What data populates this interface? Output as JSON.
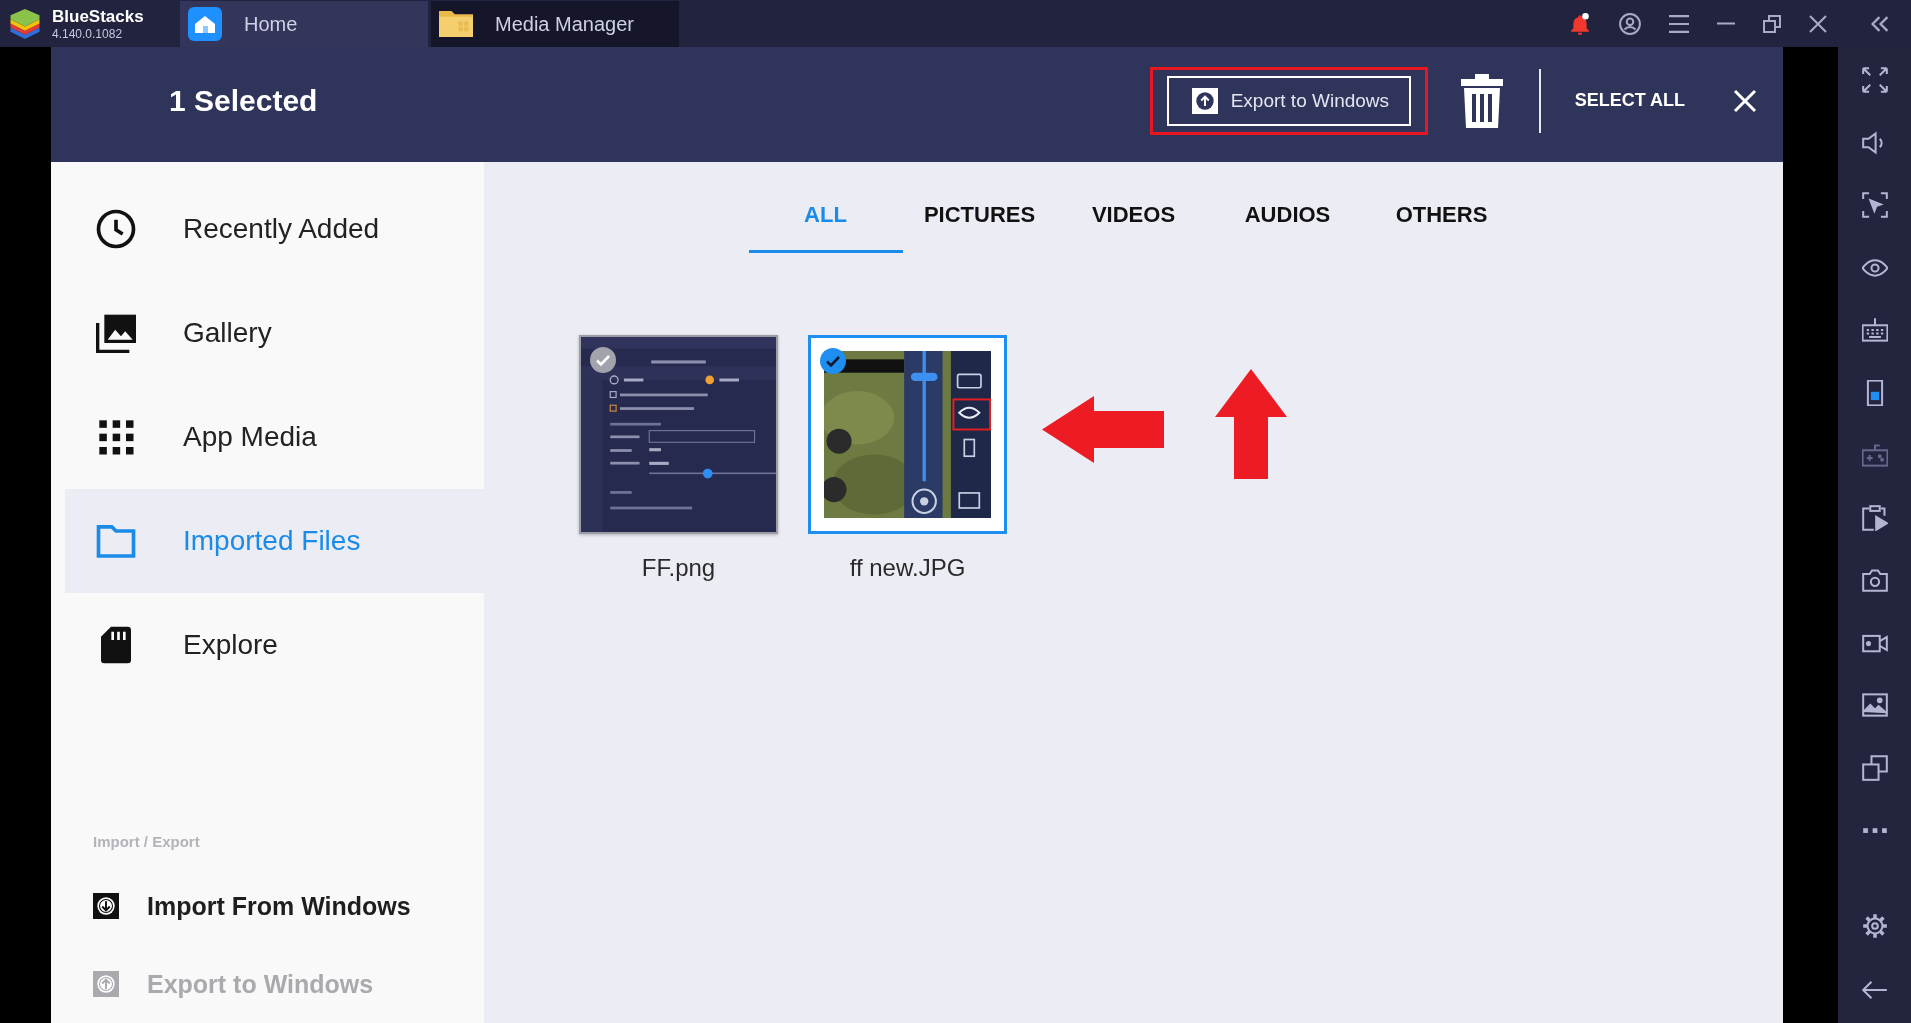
{
  "titlebar": {
    "app_name": "BlueStacks",
    "version": "4.140.0.1082",
    "tabs": [
      {
        "label": "Home",
        "kind": "home",
        "selected": false
      },
      {
        "label": "Media Manager",
        "kind": "folder",
        "selected": true
      }
    ],
    "notification_unread": true
  },
  "header": {
    "title": "1 Selected",
    "export_button": {
      "label": "Export to Windows",
      "highlighted": true
    },
    "select_all": "SELECT ALL"
  },
  "sidebar": {
    "items": [
      {
        "label": "Recently Added",
        "kind": "recent",
        "selected": false
      },
      {
        "label": "Gallery",
        "kind": "gallery",
        "selected": false
      },
      {
        "label": "App Media",
        "kind": "apps",
        "selected": false
      },
      {
        "label": "Imported Files",
        "kind": "folder",
        "selected": true
      },
      {
        "label": "Explore",
        "kind": "storage",
        "selected": false
      }
    ],
    "section_label": "Import / Export",
    "actions": [
      {
        "label": "Import From Windows",
        "kind": "import",
        "disabled": false
      },
      {
        "label": "Export to Windows",
        "kind": "export",
        "disabled": true
      }
    ]
  },
  "filter_tabs": [
    {
      "label": "ALL",
      "selected": true
    },
    {
      "label": "PICTURES",
      "selected": false
    },
    {
      "label": "VIDEOS",
      "selected": false
    },
    {
      "label": "AUDIOS",
      "selected": false
    },
    {
      "label": "OTHERS",
      "selected": false
    }
  ],
  "files": [
    {
      "name": "FF.png",
      "kind": "settings",
      "selected": false
    },
    {
      "name": "ff new.JPG",
      "kind": "game",
      "selected": true
    }
  ],
  "annotations": [
    {
      "kind": "left_arrow"
    },
    {
      "kind": "up_arrow"
    }
  ],
  "toolbar": {
    "top": [
      {
        "kind": "fullscreen",
        "disabled": false
      },
      {
        "kind": "volume",
        "disabled": false
      },
      {
        "kind": "pointer",
        "disabled": false
      },
      {
        "kind": "eye",
        "disabled": false
      },
      {
        "kind": "keyboard",
        "disabled": false
      },
      {
        "kind": "phone",
        "disabled": false
      },
      {
        "kind": "gamepad",
        "disabled": true
      },
      {
        "kind": "media",
        "disabled": false
      },
      {
        "kind": "camera",
        "disabled": false
      },
      {
        "kind": "video",
        "disabled": false
      },
      {
        "kind": "image",
        "disabled": false
      },
      {
        "kind": "windows",
        "disabled": false
      },
      {
        "kind": "more",
        "disabled": false
      }
    ],
    "bottom": [
      {
        "kind": "settings",
        "disabled": false
      },
      {
        "kind": "back",
        "disabled": false
      }
    ]
  }
}
